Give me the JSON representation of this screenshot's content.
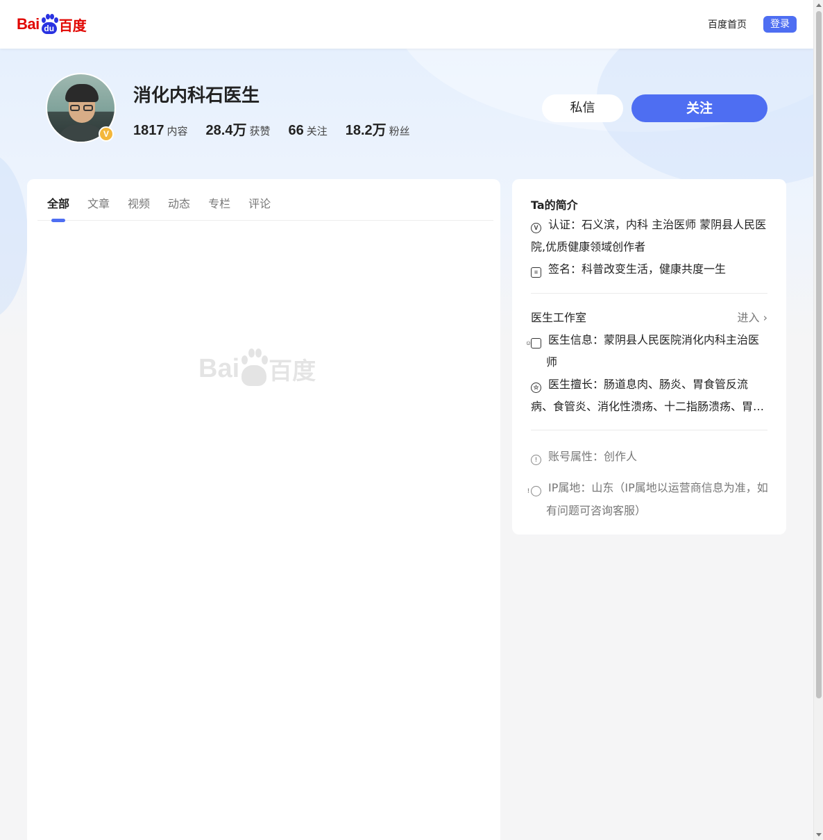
{
  "header": {
    "logo_latin": "Bai",
    "logo_du": "du",
    "logo_cn": "百度",
    "home_link": "百度首页",
    "login_label": "登录"
  },
  "profile": {
    "name": "消化内科石医生",
    "badge": "V",
    "stats": [
      {
        "value": "1817",
        "label": "内容"
      },
      {
        "value": "28.4万",
        "label": "获赞"
      },
      {
        "value": "66",
        "label": "关注"
      },
      {
        "value": "18.2万",
        "label": "粉丝"
      }
    ],
    "message_label": "私信",
    "follow_label": "关注"
  },
  "tabs": [
    {
      "label": "全部",
      "active": true
    },
    {
      "label": "文章",
      "active": false
    },
    {
      "label": "视频",
      "active": false
    },
    {
      "label": "动态",
      "active": false
    },
    {
      "label": "专栏",
      "active": false
    },
    {
      "label": "评论",
      "active": false
    }
  ],
  "watermark": {
    "latin": "Bai",
    "cn": "百度"
  },
  "side": {
    "title": "Ta的简介",
    "certification": "认证：石义滨，内科 主治医师 蒙阴县人民医院,优质健康领域创作者",
    "signature": "签名：科普改变生活，健康共度一生",
    "studio_title": "医生工作室",
    "studio_enter": "进入",
    "doctor_info": "医生信息：蒙阴县人民医院消化内科主治医师",
    "specialty": "医生擅长：肠道息肉、肠炎、胃食管反流病、食管炎、消化性溃疡、十二指肠溃疡、胃…",
    "account_type": "账号属性：创作人",
    "ip_location": "IP属地：山东（IP属地以运营商信息为准，如有问题可咨询客服）"
  },
  "colors": {
    "accent": "#4e6ef2",
    "logo_red": "#e10602",
    "logo_blue": "#2932e1",
    "badge_gold": "#f3b73b"
  }
}
